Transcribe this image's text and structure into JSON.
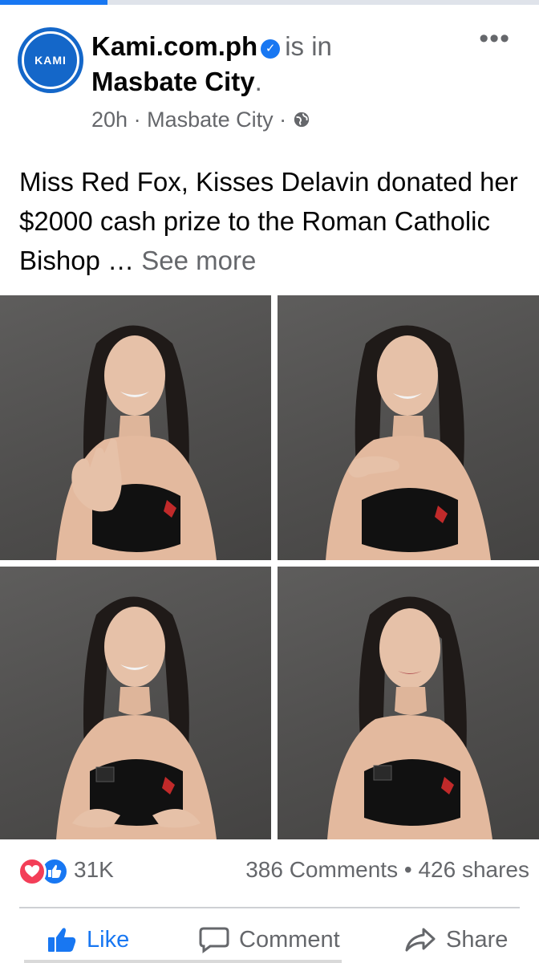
{
  "progress": {
    "fraction": 0.2,
    "color": "#1877f2"
  },
  "post": {
    "avatar_text": "KAMI",
    "page_name": "Kami.com.ph",
    "verified_icon": "verified-check-icon",
    "is_in": "is in",
    "location": "Masbate City",
    "period": ".",
    "time": "20h",
    "meta_location": "Masbate City",
    "meta_sep": "·",
    "audience_icon": "globe-icon",
    "more_icon": "•••",
    "text": "Miss Red Fox, Kisses Delavin donated her $2000 cash prize to the Roman Catholic Bishop",
    "ellipsis": " … ",
    "see_more": "See more"
  },
  "photos": [
    {
      "alt": "woman waving"
    },
    {
      "alt": "woman blowing kiss"
    },
    {
      "alt": "woman gesturing with hands"
    },
    {
      "alt": "woman smiling"
    }
  ],
  "stats": {
    "reactions": [
      "love-icon",
      "like-icon"
    ],
    "reaction_count": "31K",
    "comments": "386 Comments",
    "dot": "•",
    "shares": "426 shares"
  },
  "actions": {
    "like": "Like",
    "comment": "Comment",
    "share": "Share"
  },
  "colors": {
    "accent": "#1877f2",
    "love": "#f33e58",
    "muted": "#65676b"
  }
}
